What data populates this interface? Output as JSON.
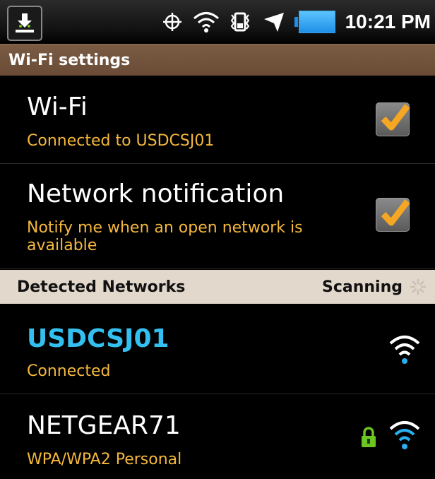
{
  "status_bar": {
    "time": "10:21 PM",
    "icons": [
      "download-icon",
      "gps-icon",
      "wifi-icon",
      "vibrate-icon",
      "airplane-icon",
      "battery-icon"
    ]
  },
  "title": "Wi-Fi settings",
  "settings": [
    {
      "label": "Wi-Fi",
      "summary": "Connected to USDCSJ01",
      "checked": true
    },
    {
      "label": "Network notification",
      "summary": "Notify me when an open network is available",
      "checked": true
    }
  ],
  "section": {
    "title": "Detected Networks",
    "status": "Scanning"
  },
  "networks": [
    {
      "ssid": "USDCSJ01",
      "status": "Connected",
      "secured": false,
      "connected": true
    },
    {
      "ssid": "NETGEAR71",
      "status": "WPA/WPA2 Personal",
      "secured": true,
      "connected": false
    }
  ],
  "colors": {
    "accent_connected": "#33c0f0",
    "summary_text": "#f5b83c",
    "titlebar": "#6a4b35",
    "section_bg": "#e2d8cc",
    "checkbox_check": "#f5a623",
    "lock": "#6cc520"
  }
}
